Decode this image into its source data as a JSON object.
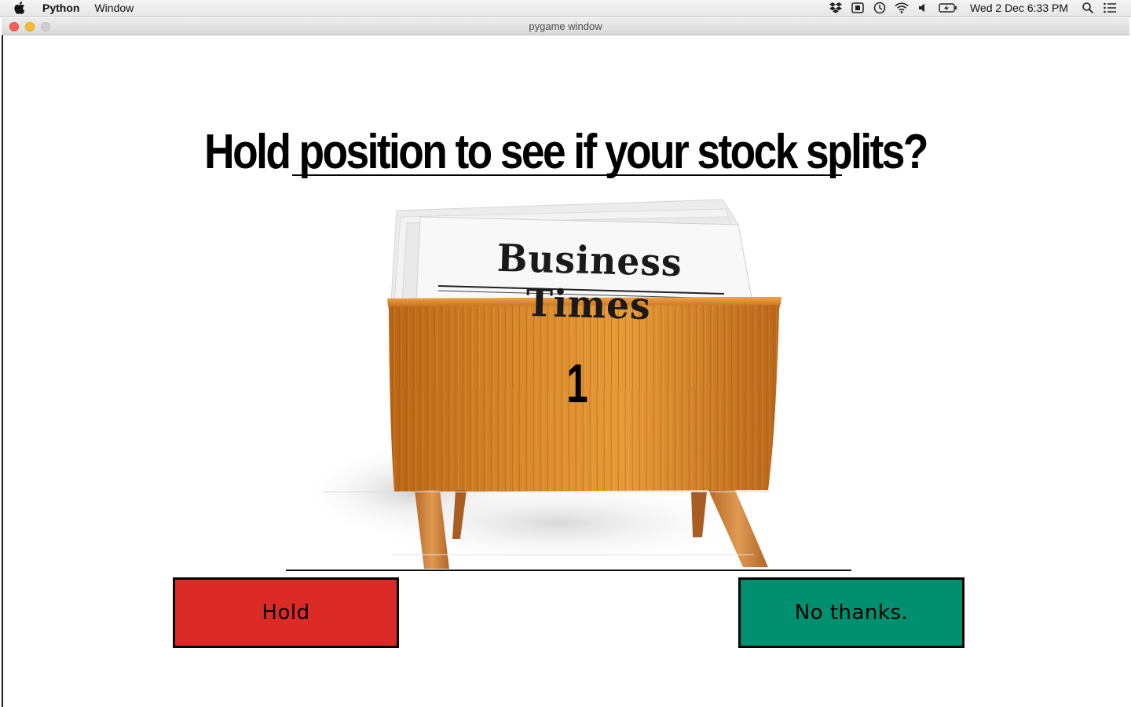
{
  "menubar": {
    "app_name": "Python",
    "menu_items": [
      "Window"
    ],
    "clock": "Wed 2 Dec  6:33 PM"
  },
  "window": {
    "title": "pygame window"
  },
  "game": {
    "headline": "Hold position to see if your stock splits?",
    "newspaper_masthead": "Business Times",
    "counter": "1",
    "buttons": {
      "hold": "Hold",
      "decline": "No thanks."
    }
  },
  "colors": {
    "hold_button": "#dc2b27",
    "decline_button": "#008f6f",
    "wood": "#c97a22"
  }
}
